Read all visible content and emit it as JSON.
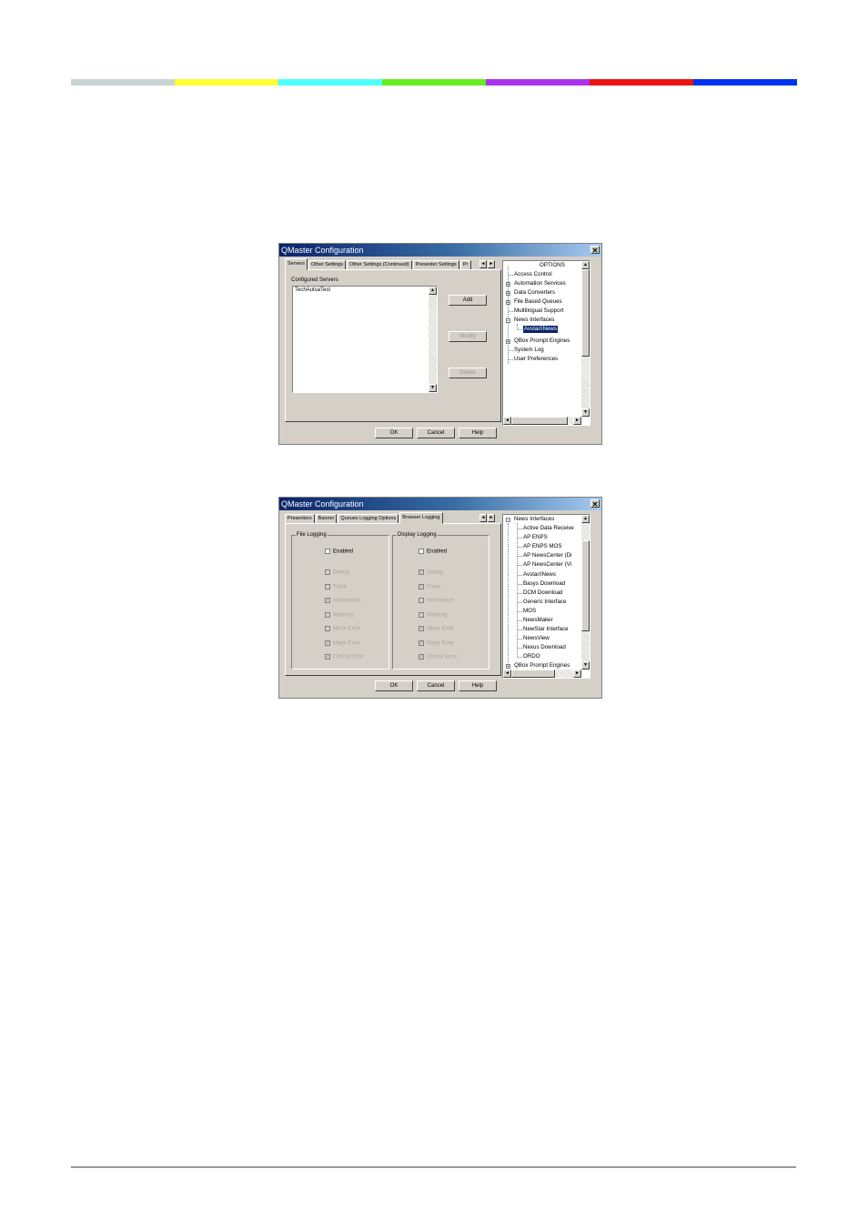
{
  "colorbar": [
    "#c8d4d4",
    "#ffff33",
    "#4dffff",
    "#66ee22",
    "#aa33ee",
    "#ee1111",
    "#0033ee"
  ],
  "dialog1": {
    "title": "QMaster Configuration",
    "tabs": [
      "Servers",
      "Other Settings",
      "Other Settings (Continued)",
      "Presenter Settings",
      "Pr"
    ],
    "configured_label": "Configured Servers",
    "servers": [
      "TechAutsaTest"
    ],
    "buttons": {
      "add": "Add",
      "modify": "Modify",
      "delete": "Delete"
    },
    "footer": {
      "ok": "OK",
      "cancel": "Cancel",
      "help": "Help"
    },
    "tree": {
      "root": "OPTIONS",
      "items": [
        "Access Control",
        "Automation Services",
        "Data Converters",
        "File Based Queues",
        "Multilingual Support",
        "News Interfaces",
        "Avstar/iNews",
        "QBox Prompt Engines",
        "System Log",
        "User Preferences"
      ]
    }
  },
  "dialog2": {
    "title": "QMaster Configuration",
    "tabs": [
      "Presenters",
      "Banner",
      "Queues Logging Options",
      "Browser Logging"
    ],
    "file_logging": {
      "legend": "File Logging",
      "enabled": "Enabled",
      "levels": [
        "Debug",
        "Trace",
        "Information",
        "Warning",
        "Minor Error",
        "Major Error",
        "Critical Error"
      ]
    },
    "display_logging": {
      "legend": "Display Logging",
      "enabled": "Enabled",
      "levels": [
        "Debug",
        "Trace",
        "Information",
        "Warning",
        "Minor Error",
        "Major Error",
        "Critical Error"
      ]
    },
    "footer": {
      "ok": "OK",
      "cancel": "Cancel",
      "help": "Help"
    },
    "tree": {
      "root": "News Interfaces",
      "items": [
        "Active Data Receive",
        "AP ENPS",
        "AP ENPS MOS",
        "AP NewsCenter (Di",
        "AP NewsCenter (Vi",
        "Avstar/iNews",
        "Basys Download",
        "DCM Download",
        "Generic Interface",
        "MOS",
        "NewsMaker",
        "NewStar Interface",
        "NewsView",
        "Nexus Download",
        "ORDO"
      ],
      "last": "QBox Prompt Engines"
    }
  }
}
